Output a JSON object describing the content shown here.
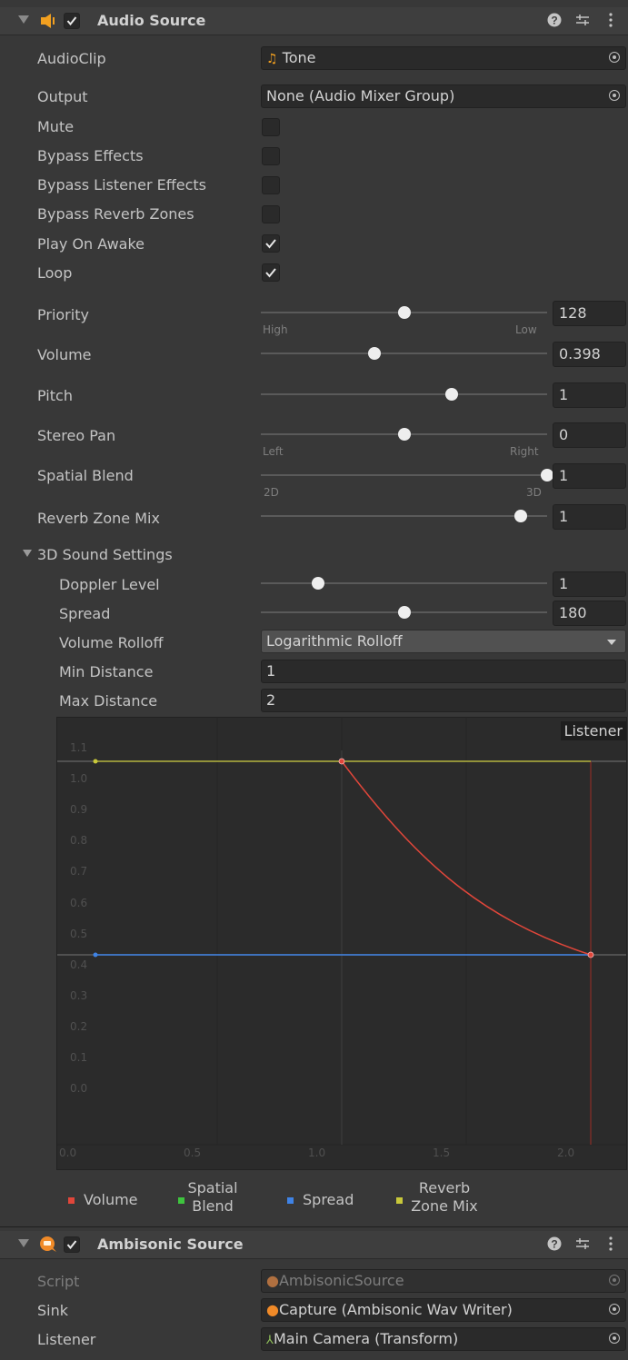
{
  "audio_source": {
    "title": "Audio Source",
    "enabled": true,
    "fields": {
      "audioclip": {
        "label": "AudioClip",
        "value": "Tone"
      },
      "output": {
        "label": "Output",
        "value": "None (Audio Mixer Group)"
      },
      "mute": {
        "label": "Mute",
        "checked": false
      },
      "bypass_effects": {
        "label": "Bypass Effects",
        "checked": false
      },
      "bypass_listener_effects": {
        "label": "Bypass Listener Effects",
        "checked": false
      },
      "bypass_reverb_zones": {
        "label": "Bypass Reverb Zones",
        "checked": false
      },
      "play_on_awake": {
        "label": "Play On Awake",
        "checked": true
      },
      "loop": {
        "label": "Loop",
        "checked": true
      }
    },
    "sliders": {
      "priority": {
        "label": "Priority",
        "value": "128",
        "min_label": "High",
        "max_label": "Low",
        "fraction": 0.5
      },
      "volume": {
        "label": "Volume",
        "value": "0.398",
        "fraction": 0.398
      },
      "pitch": {
        "label": "Pitch",
        "value": "1",
        "fraction": 0.667
      },
      "stereo_pan": {
        "label": "Stereo Pan",
        "value": "0",
        "min_label": "Left",
        "max_label": "Right",
        "fraction": 0.5
      },
      "spatial_blend": {
        "label": "Spatial Blend",
        "value": "1",
        "min_label": "2D",
        "max_label": "3D",
        "fraction": 1.0
      },
      "reverb_zone_mix": {
        "label": "Reverb Zone Mix",
        "value": "1",
        "fraction": 0.909
      }
    },
    "sound3d": {
      "header": "3D Sound Settings",
      "doppler": {
        "label": "Doppler Level",
        "value": "1",
        "fraction": 0.2
      },
      "spread": {
        "label": "Spread",
        "value": "180",
        "fraction": 0.5
      },
      "rolloff": {
        "label": "Volume Rolloff",
        "value": "Logarithmic Rolloff"
      },
      "min_distance": {
        "label": "Min Distance",
        "value": "1"
      },
      "max_distance": {
        "label": "Max Distance",
        "value": "2"
      }
    },
    "graph": {
      "listener_label": "Listener",
      "y_ticks": [
        "1.1",
        "1.0",
        "0.9",
        "0.8",
        "0.7",
        "0.6",
        "0.5",
        "0.4",
        "0.3",
        "0.2",
        "0.1",
        "0.0"
      ],
      "x_ticks": [
        "0.0",
        "0.5",
        "1.0",
        "1.5",
        "2.0"
      ],
      "legend": [
        {
          "name": "Volume",
          "color": "#e0463a"
        },
        {
          "name": "Spatial Blend",
          "color": "#3ec43e"
        },
        {
          "name": "Spread",
          "color": "#3f83e6"
        },
        {
          "name": "Reverb Zone Mix",
          "color": "#c8c83a"
        }
      ]
    }
  },
  "ambisonic_source": {
    "title": "Ambisonic Source",
    "enabled": true,
    "script": {
      "label": "Script",
      "value": "AmbisonicSource"
    },
    "sink": {
      "label": "Sink",
      "value": "Capture (Ambisonic Wav Writer)"
    },
    "listener": {
      "label": "Listener",
      "value": "Main Camera (Transform)"
    }
  }
}
